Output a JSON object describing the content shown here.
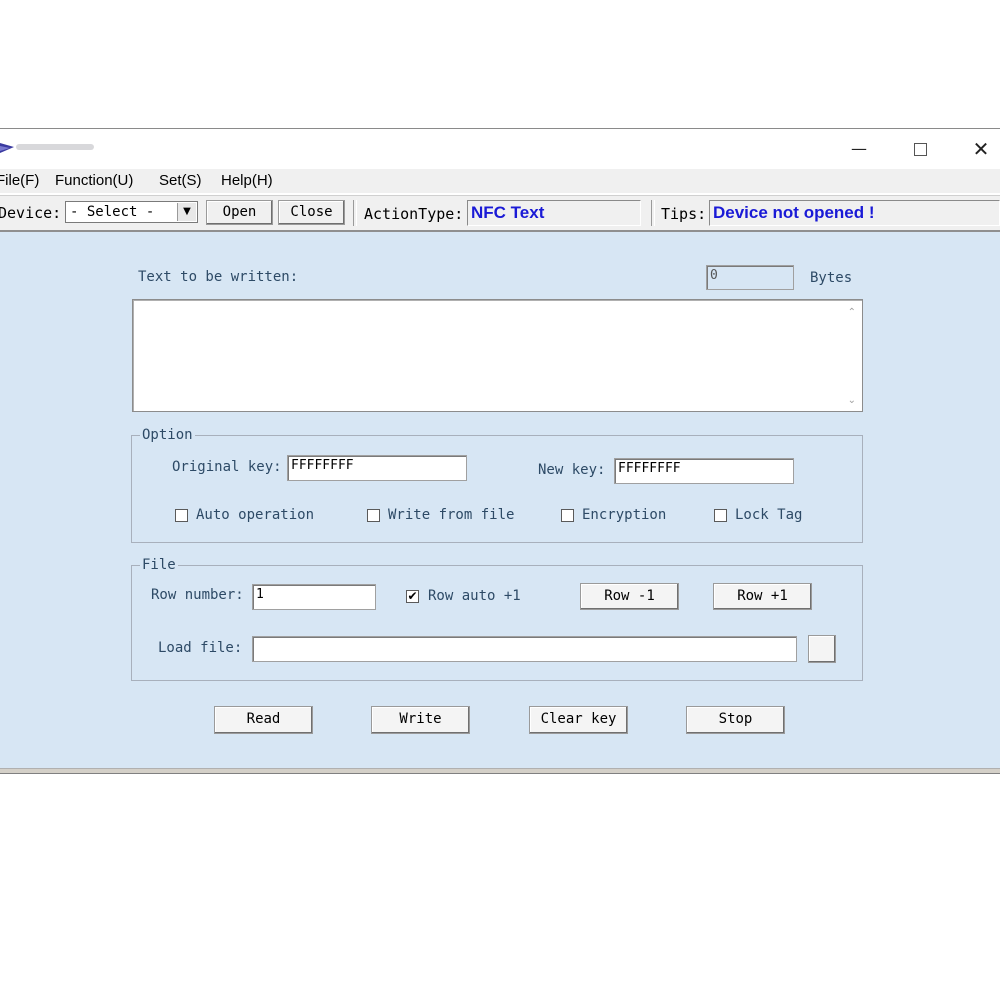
{
  "menu": [
    "File(F)",
    "Function(U)",
    "Set(S)",
    "Help(H)"
  ],
  "toolbar": {
    "device_label": "Device:",
    "device_select": "- Select -",
    "open_label": "Open",
    "close_label": "Close",
    "action_type_label": "ActionType:",
    "action_type_value": "NFC Text",
    "tips_label": "Tips:",
    "tips_value": "Device not opened !"
  },
  "text_section": {
    "label": "Text to be written:",
    "bytes_value": "0",
    "bytes_label": "Bytes",
    "content": ""
  },
  "option": {
    "title": "Option",
    "original_key_label": "Original key:",
    "original_key_value": "FFFFFFFF",
    "new_key_label": "New key:",
    "new_key_value": "FFFFFFFF",
    "checkboxes": [
      {
        "label": "Auto operation",
        "checked": false
      },
      {
        "label": "Write from file",
        "checked": false
      },
      {
        "label": "Encryption",
        "checked": false
      },
      {
        "label": "Lock Tag",
        "checked": false
      }
    ]
  },
  "file": {
    "title": "File",
    "row_number_label": "Row number:",
    "row_number_value": "1",
    "row_auto_label": "Row auto +1",
    "row_auto_checked": true,
    "row_minus_label": "Row -1",
    "row_plus_label": "Row +1",
    "load_file_label": "Load file:",
    "load_file_value": ""
  },
  "actions": {
    "read": "Read",
    "write": "Write",
    "clear_key": "Clear key",
    "stop": "Stop"
  },
  "colors": {
    "client_bg": "#d7e6f4",
    "status_text": "#1a1ad6"
  },
  "icons": {
    "minimize": "minimize-icon",
    "maximize": "maximize-icon",
    "close": "close-icon",
    "dropdown": "chevron-down-icon"
  }
}
